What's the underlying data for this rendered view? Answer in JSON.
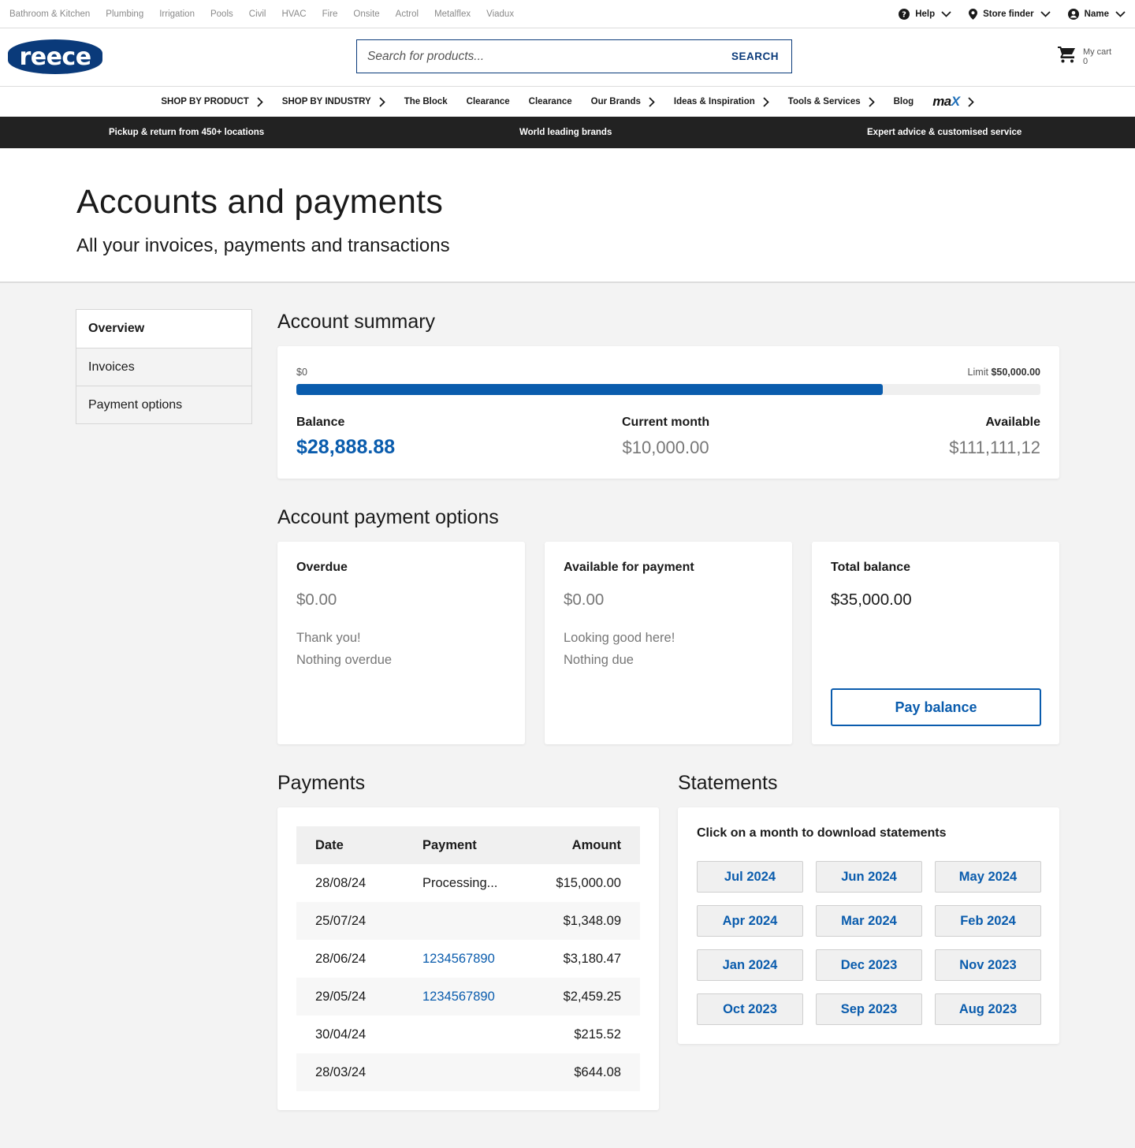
{
  "utility": {
    "brands": [
      "Bathroom & Kitchen",
      "Plumbing",
      "Irrigation",
      "Pools",
      "Civil",
      "HVAC",
      "Fire",
      "Onsite",
      "Actrol",
      "Metalflex",
      "Viadux"
    ],
    "help": "Help",
    "store_finder": "Store finder",
    "account": "Name"
  },
  "header": {
    "logo": "reece",
    "search_placeholder": "Search for products...",
    "search_button": "SEARCH",
    "cart_label": "My cart",
    "cart_count": "0"
  },
  "nav": {
    "items": [
      {
        "label": "SHOP BY PRODUCT",
        "chevron": true
      },
      {
        "label": "SHOP BY INDUSTRY",
        "chevron": true
      },
      {
        "label": "The Block",
        "chevron": false
      },
      {
        "label": "Clearance",
        "chevron": false
      },
      {
        "label": "Clearance",
        "chevron": false
      },
      {
        "label": "Our Brands",
        "chevron": true
      },
      {
        "label": "Ideas & Inspiration",
        "chevron": true
      },
      {
        "label": "Tools & Services",
        "chevron": true
      },
      {
        "label": "Blog",
        "chevron": false
      }
    ],
    "max_logo": "max"
  },
  "promo": {
    "left": "Pickup & return from 450+ locations",
    "center": "World leading brands",
    "right": "Expert advice & customised service"
  },
  "page": {
    "title": "Accounts and payments",
    "subtitle": "All your invoices, payments and transactions"
  },
  "sidenav": {
    "items": [
      "Overview",
      "Invoices",
      "Payment options"
    ]
  },
  "summary": {
    "title": "Account summary",
    "min_label": "$0",
    "limit_label": "Limit",
    "limit_value": "$50,000.00",
    "usage_fraction": 0.788,
    "balance_label": "Balance",
    "balance_value": "$28,888.88",
    "current_label": "Current month",
    "current_value": "$10,000.00",
    "available_label": "Available",
    "available_value": "$111,111,12"
  },
  "options": {
    "title": "Account payment options",
    "overdue": {
      "label": "Overdue",
      "value": "$0.00",
      "line1": "Thank you!",
      "line2": "Nothing overdue"
    },
    "available": {
      "label": "Available for payment",
      "value": "$0.00",
      "line1": "Looking good here!",
      "line2": "Nothing due"
    },
    "total": {
      "label": "Total balance",
      "value": "$35,000.00",
      "button": "Pay balance"
    }
  },
  "payments": {
    "title": "Payments",
    "headers": {
      "date": "Date",
      "payment": "Payment",
      "amount": "Amount"
    },
    "rows": [
      {
        "date": "28/08/24",
        "payment": "Processing...",
        "amount": "$15,000.00"
      },
      {
        "date": "25/07/24",
        "payment": "",
        "amount": "$1,348.09"
      },
      {
        "date": "28/06/24",
        "payment": "1234567890",
        "amount": "$3,180.47"
      },
      {
        "date": "29/05/24",
        "payment": "1234567890",
        "amount": "$2,459.25"
      },
      {
        "date": "30/04/24",
        "payment": "",
        "amount": "$215.52"
      },
      {
        "date": "28/03/24",
        "payment": "",
        "amount": "$644.08"
      }
    ]
  },
  "statements": {
    "title": "Statements",
    "instruction": "Click on a month to download statements",
    "months": [
      "Jul 2024",
      "Jun 2024",
      "May 2024",
      "Apr 2024",
      "Mar 2024",
      "Feb 2024",
      "Jan 2024",
      "Dec 2023",
      "Nov 2023",
      "Oct 2023",
      "Sep 2023",
      "Aug 2023"
    ]
  },
  "colors": {
    "brand_navy": "#0a3a7a",
    "accent_blue": "#0a5cad",
    "promo_bg": "#222222"
  }
}
